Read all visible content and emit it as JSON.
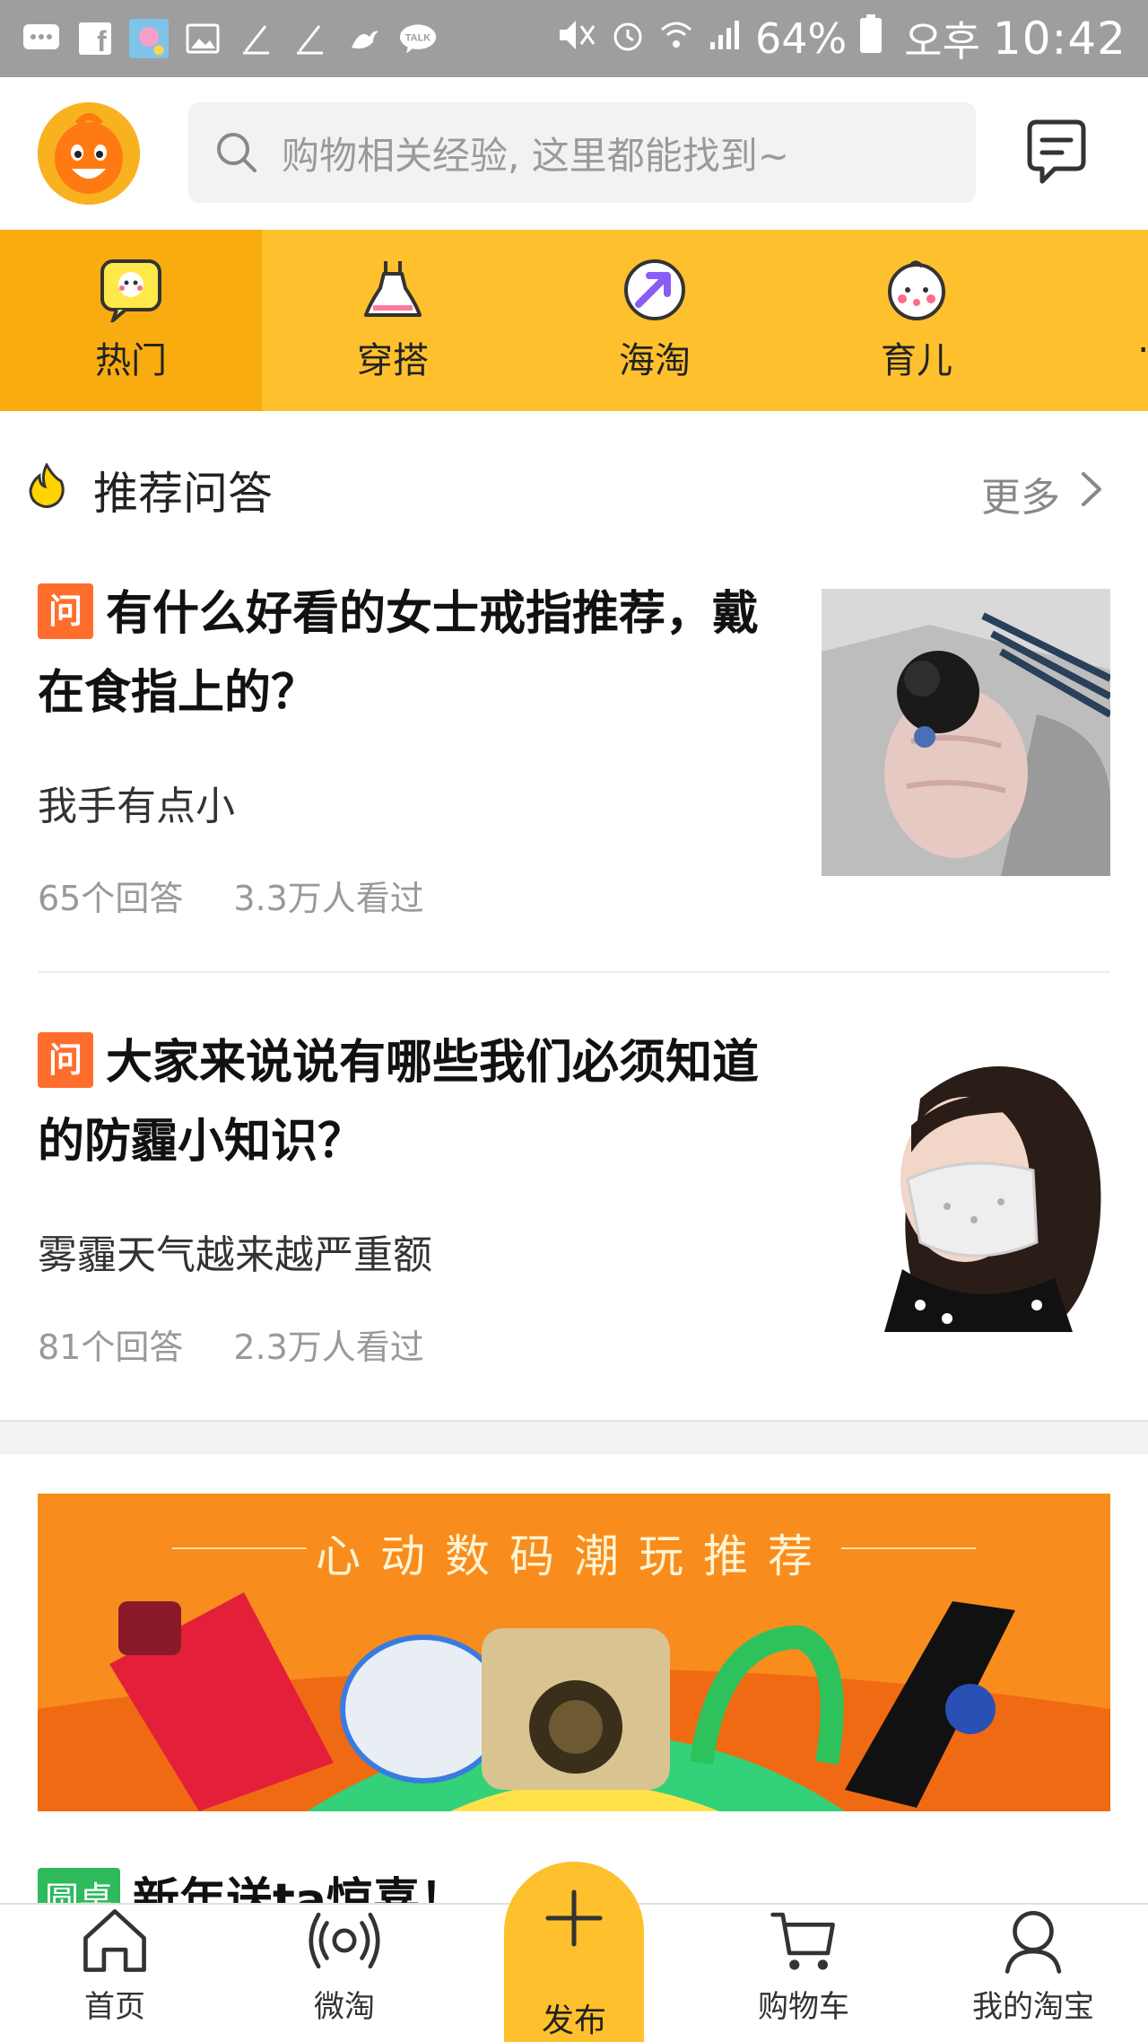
{
  "status_bar": {
    "battery": "64%",
    "ampm": "오후",
    "time": "10:42",
    "talk_label": "TALK"
  },
  "header": {
    "search_placeholder": "购物相关经验, 这里都能找到~"
  },
  "categories": [
    {
      "label": "热门",
      "active": true
    },
    {
      "label": "穿搭",
      "active": false
    },
    {
      "label": "海淘",
      "active": false
    },
    {
      "label": "育儿",
      "active": false
    }
  ],
  "section": {
    "title": "推荐问答",
    "more": "更多"
  },
  "questions": [
    {
      "badge": "问",
      "title": "有什么好看的女士戒指推荐，戴在食指上的？",
      "desc": "我手有点小",
      "answers": "65个回答",
      "views": "3.3万人看过"
    },
    {
      "badge": "问",
      "title": "大家来说说有哪些我们必须知道的防霾小知识？",
      "desc": "雾霾天气越来越严重额",
      "answers": "81个回答",
      "views": "2.3万人看过"
    }
  ],
  "banner": {
    "title": "心动数码潮玩推荐"
  },
  "teaser": {
    "badge": "圆桌",
    "text": "新年送ta惊喜！"
  },
  "tabbar": {
    "home": "首页",
    "weitao": "微淘",
    "publish": "发布",
    "cart": "购物车",
    "mine": "我的淘宝"
  },
  "colors": {
    "accent_yellow": "#fec02c",
    "active_tab": "#f9ac10",
    "question_badge": "#ff6e2c",
    "roundtable_badge": "#2dbb5c",
    "banner_orange": "#f88c1d"
  }
}
